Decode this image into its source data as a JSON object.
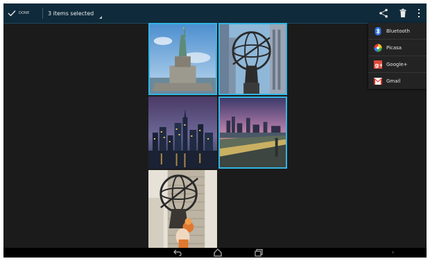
{
  "action_bar": {
    "done_label": "DONE",
    "selection_label": "3 items selected",
    "icons": [
      "checkmark-icon",
      "share-icon",
      "trash-icon",
      "overflow-menu-icon"
    ],
    "background_color": "#0f2a3a"
  },
  "share_menu": {
    "items": [
      {
        "label": "Bluetooth",
        "icon": "bluetooth-icon"
      },
      {
        "label": "Picasa",
        "icon": "picasa-icon"
      },
      {
        "label": "Google+",
        "icon": "google-plus-icon"
      },
      {
        "label": "Gmail",
        "icon": "gmail-icon"
      }
    ]
  },
  "gallery": {
    "photos": [
      {
        "subject": "statue-of-liberty",
        "selected": true
      },
      {
        "subject": "atlas-statue",
        "selected": true
      },
      {
        "subject": "city-skyline-night",
        "selected": false
      },
      {
        "subject": "city-skyline-dusk",
        "selected": true
      },
      {
        "subject": "atlas-statue-figurine",
        "selected": false
      }
    ],
    "selection_color": "#33b5e5"
  },
  "nav_bar": {
    "buttons": [
      "back-icon",
      "home-icon",
      "recent-apps-icon"
    ]
  }
}
